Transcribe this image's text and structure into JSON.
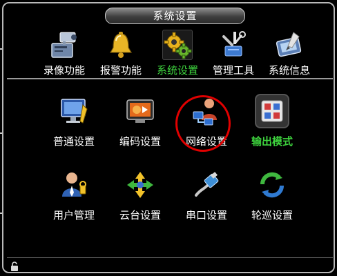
{
  "window": {
    "title": "系统设置"
  },
  "tabs": [
    {
      "label": "录像功能",
      "icon": "video-recorder-icon",
      "active": false
    },
    {
      "label": "报警功能",
      "icon": "alarm-bell-icon",
      "active": false
    },
    {
      "label": "系统设置",
      "icon": "gear-settings-icon",
      "active": true
    },
    {
      "label": "管理工具",
      "icon": "tools-icon",
      "active": false
    },
    {
      "label": "系统信息",
      "icon": "system-info-icon",
      "active": false
    }
  ],
  "items": [
    {
      "label": "普通设置",
      "icon": "monitor-settings-icon",
      "active": false
    },
    {
      "label": "编码设置",
      "icon": "encode-settings-icon",
      "active": false
    },
    {
      "label": "网络设置",
      "icon": "network-settings-icon",
      "active": false,
      "circled": true
    },
    {
      "label": "输出模式",
      "icon": "output-mode-icon",
      "active": true
    },
    {
      "label": "用户管理",
      "icon": "user-management-icon",
      "active": false
    },
    {
      "label": "云台设置",
      "icon": "ptz-settings-icon",
      "active": false
    },
    {
      "label": "串口设置",
      "icon": "serial-port-icon",
      "active": false
    },
    {
      "label": "轮巡设置",
      "icon": "tour-cycle-icon",
      "active": false
    }
  ],
  "colors": {
    "active_text": "#3ed43e",
    "highlight_circle": "#e00000",
    "border": "#b9b9b9"
  }
}
